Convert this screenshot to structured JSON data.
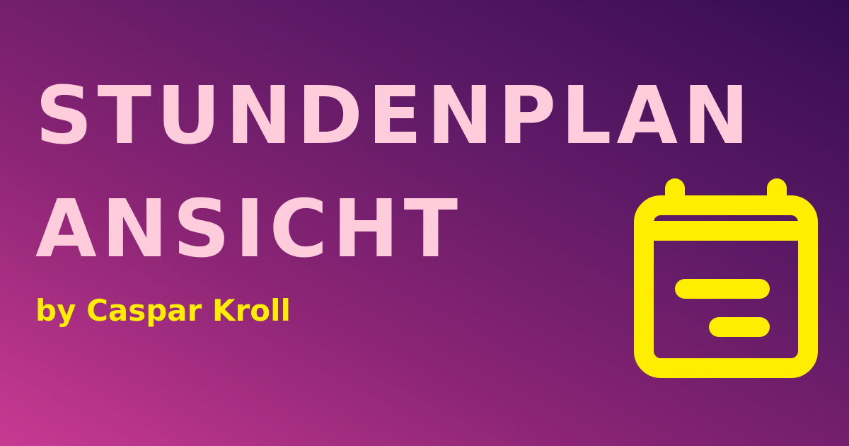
{
  "title": {
    "line1": "STUNDENPLAN",
    "line2": "ANSICHT"
  },
  "byline": "by Caspar Kroll",
  "icon": "calendar-icon",
  "colors": {
    "title": "#ffccdc",
    "accent": "#ffee00",
    "gradient_start": "#c83a92",
    "gradient_end": "#340c52"
  }
}
